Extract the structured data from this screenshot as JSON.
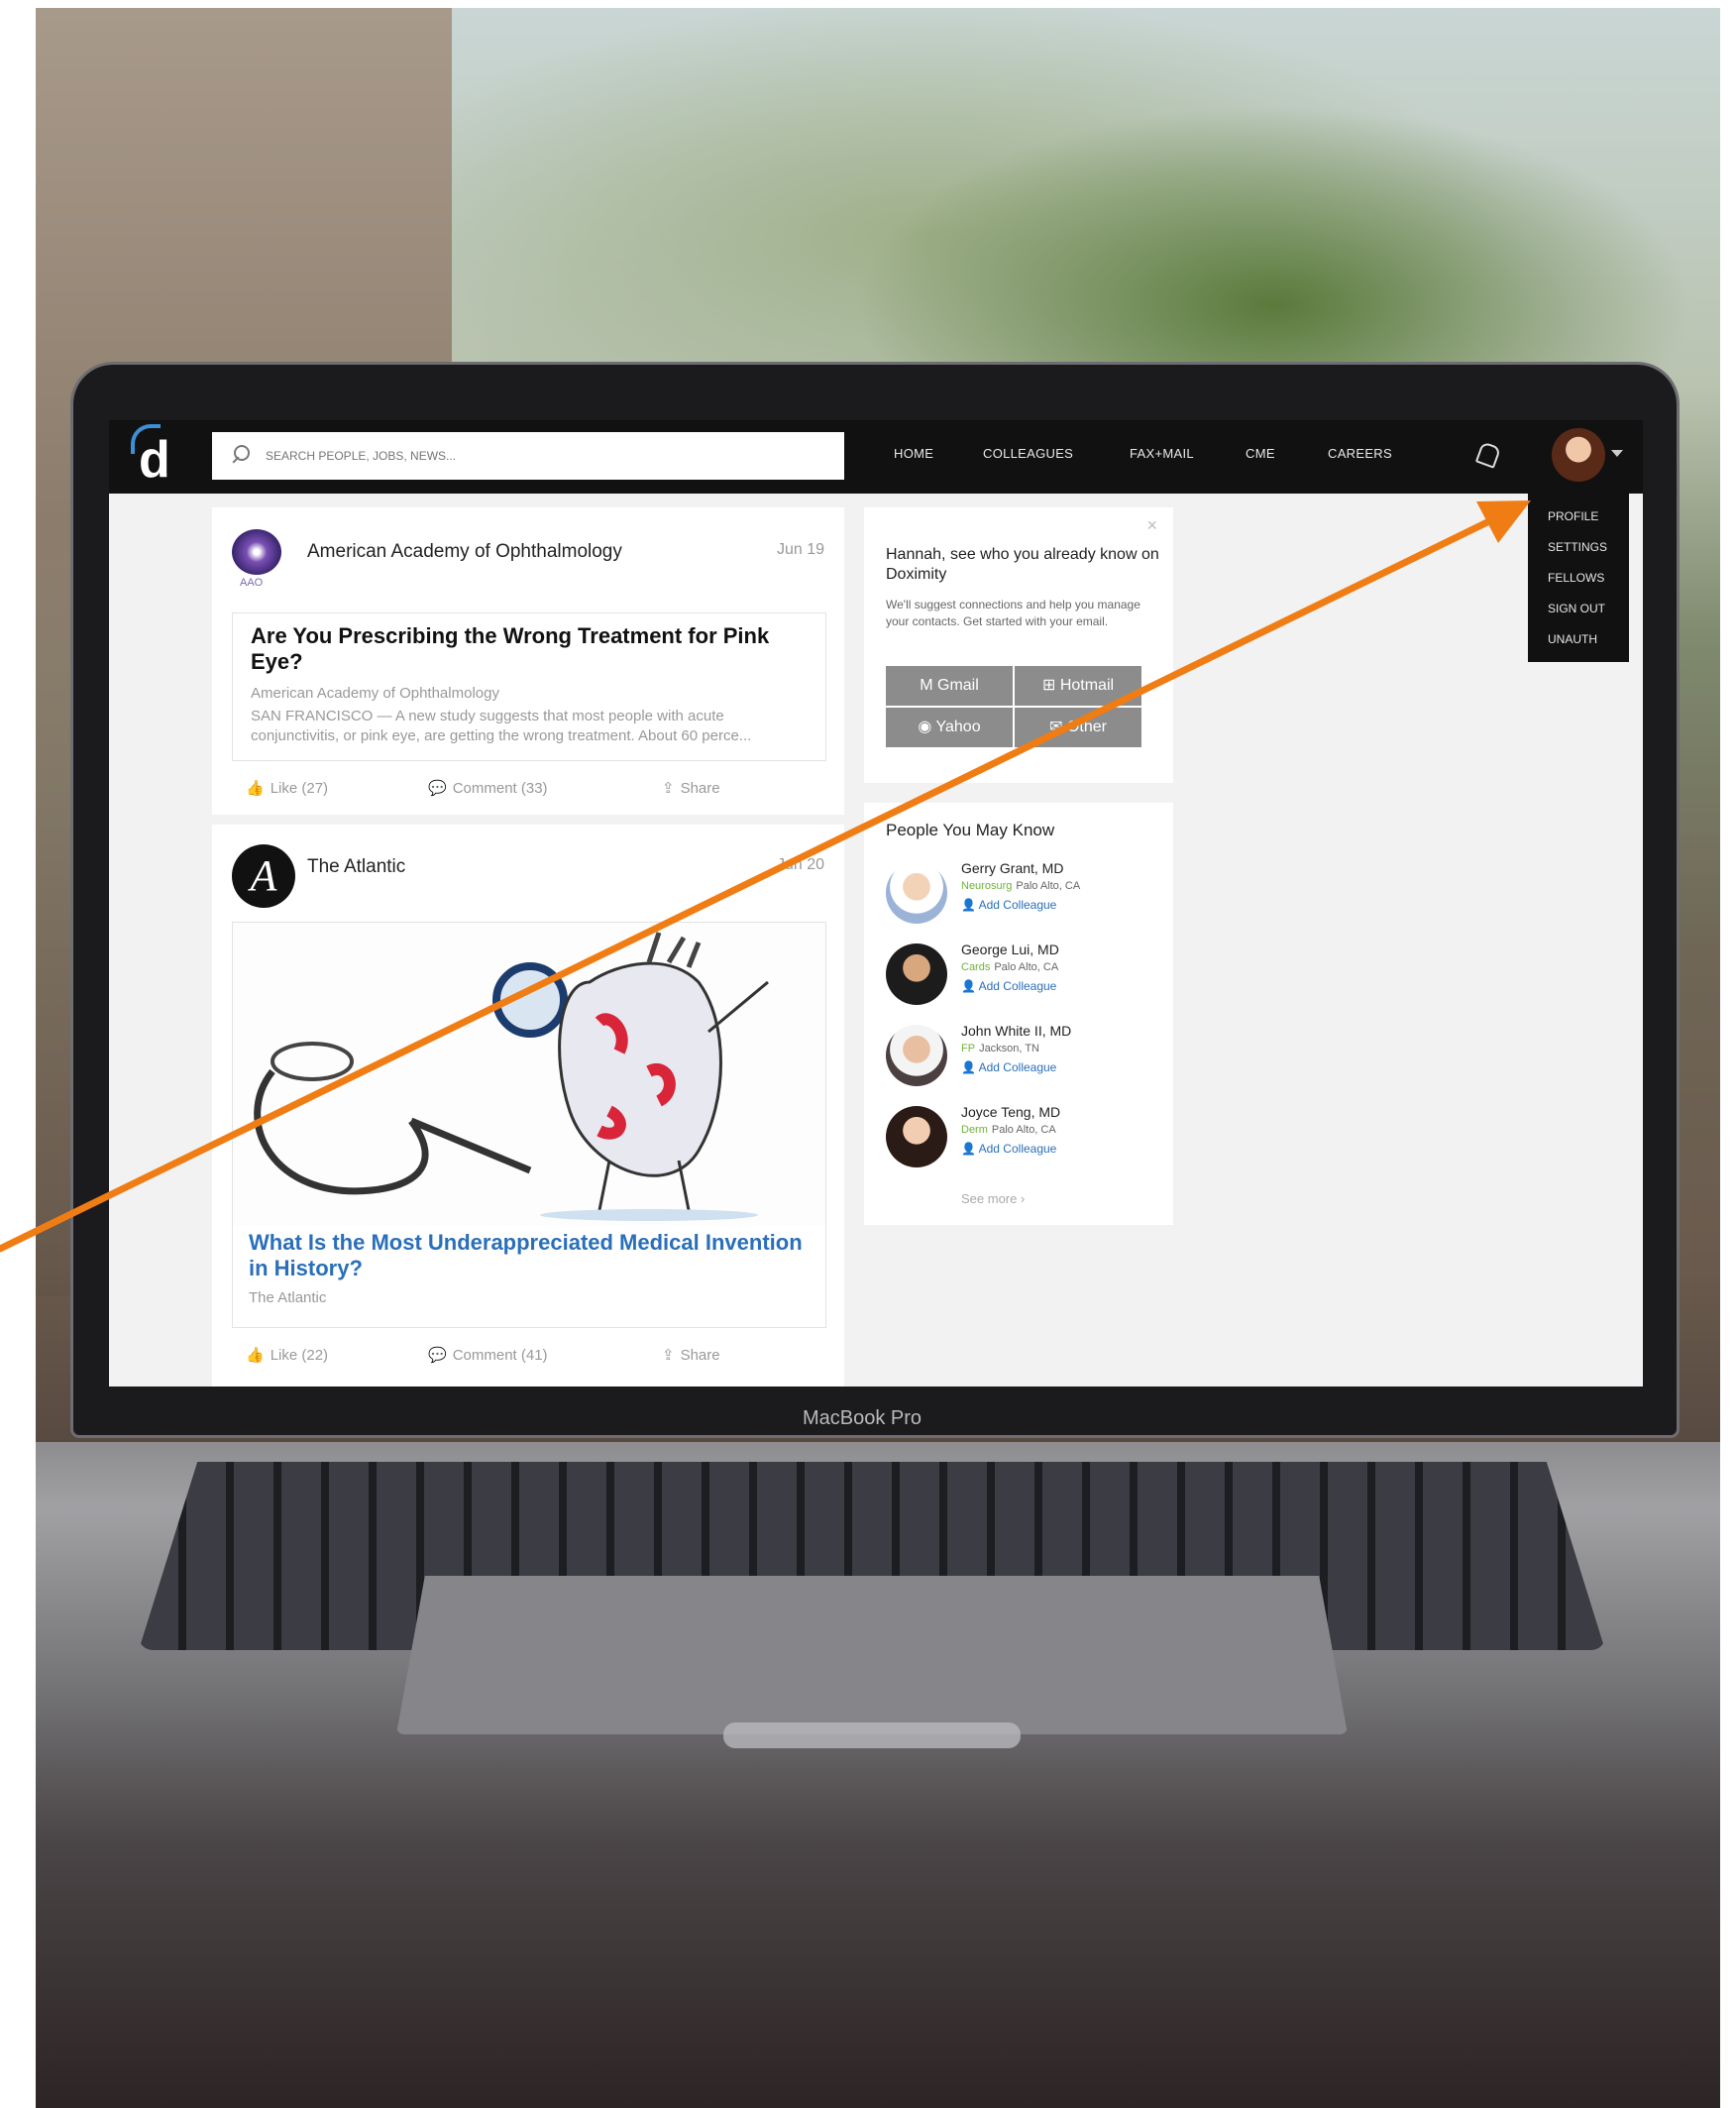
{
  "laptop": {
    "label": "MacBook Pro"
  },
  "topbar": {
    "search_placeholder": "SEARCH PEOPLE, JOBS, NEWS...",
    "nav": [
      "HOME",
      "COLLEAGUES",
      "FAX+MAIL",
      "CME",
      "CAREERS"
    ]
  },
  "user_menu": {
    "items": [
      "PROFILE",
      "SETTINGS",
      "FELLOWS",
      "SIGN OUT",
      "UNAUTH"
    ]
  },
  "feed": {
    "posts": [
      {
        "source": "American Academy of Ophthalmology",
        "source_abbr": "AAO",
        "date": "Jun 19",
        "article_title": "Are You Prescribing the Wrong Treatment for Pink Eye?",
        "article_source": "American Academy of Ophthalmology",
        "article_snippet": "SAN FRANCISCO — A new study suggests that most people with acute conjunctivitis, or pink eye, are getting the wrong treatment. About 60 perce...",
        "like": "Like (27)",
        "comment": "Comment (33)",
        "share": "Share"
      },
      {
        "source": "The Atlantic",
        "source_logo_letter": "A",
        "date": "Jun 20",
        "article_title": "What Is the Most Underappreciated Medical Invention in History?",
        "article_source": "The Atlantic",
        "like": "Like (22)",
        "comment": "Comment (41)",
        "share": "Share"
      }
    ]
  },
  "suggest": {
    "close": "×",
    "title": "Hannah, see who you already know on Doximity",
    "body": "We'll suggest connections and help you manage your contacts. Get started with your email.",
    "providers": [
      "Gmail",
      "Hotmail",
      "Yahoo",
      "Other"
    ]
  },
  "pymk": {
    "title": "People You May Know",
    "people": [
      {
        "name": "Gerry Grant, MD",
        "specialty": "Neurosurg",
        "location": "Palo Alto, CA",
        "action": "Add Colleague"
      },
      {
        "name": "George Lui, MD",
        "specialty": "Cards",
        "location": "Palo Alto, CA",
        "action": "Add Colleague"
      },
      {
        "name": "John White II, MD",
        "specialty": "FP",
        "location": "Jackson, TN",
        "action": "Add Colleague"
      },
      {
        "name": "Joyce Teng, MD",
        "specialty": "Derm",
        "location": "Palo Alto, CA",
        "action": "Add Colleague"
      }
    ],
    "see_more": "See more ›"
  },
  "colors": {
    "accent_blue": "#2a6fba",
    "specialty_green": "#6fb23a",
    "annotation_arrow": "#f07c14",
    "topbar": "#111111"
  }
}
